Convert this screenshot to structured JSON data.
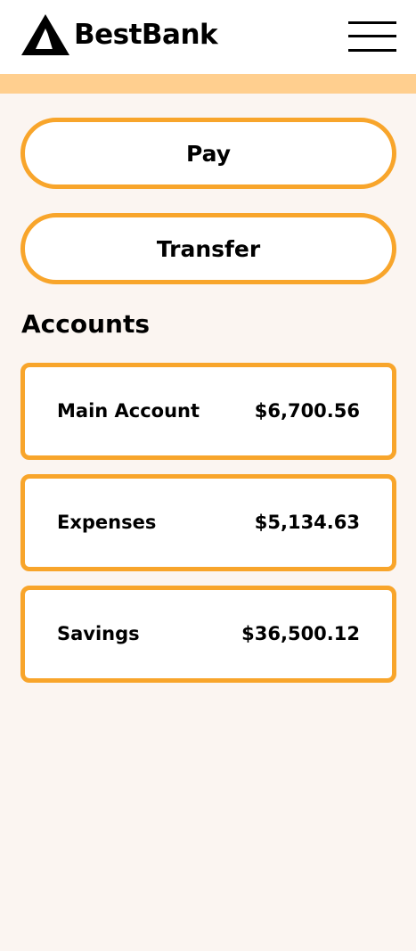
{
  "brand": {
    "name": "BestBank",
    "logo_icon": "triangle-logo-icon",
    "accent_color": "#f8a52b",
    "banner_color": "#ffcf8f",
    "background_color": "#fbf5f1"
  },
  "header": {
    "menu_icon": "hamburger-menu-icon"
  },
  "actions": {
    "pay_label": "Pay",
    "transfer_label": "Transfer"
  },
  "accounts": {
    "title": "Accounts",
    "items": [
      {
        "name": "Main Account",
        "balance": "$6,700.56"
      },
      {
        "name": "Expenses",
        "balance": "$5,134.63"
      },
      {
        "name": "Savings",
        "balance": "$36,500.12"
      }
    ]
  }
}
